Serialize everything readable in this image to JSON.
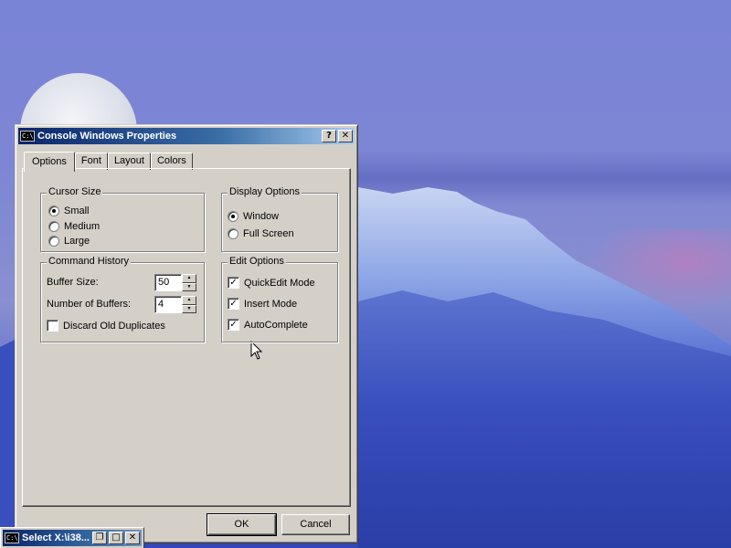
{
  "dialog": {
    "title": "Console Windows Properties",
    "app_icon_text": "C:\\",
    "help_button": "?",
    "close_button": "✕",
    "tabs": [
      "Options",
      "Font",
      "Layout",
      "Colors"
    ],
    "active_tab": "Options",
    "cursor_size": {
      "legend": "Cursor Size",
      "options": [
        "Small",
        "Medium",
        "Large"
      ],
      "selected": "Small"
    },
    "display_options": {
      "legend": "Display Options",
      "options": [
        "Window",
        "Full Screen"
      ],
      "selected": "Window"
    },
    "command_history": {
      "legend": "Command History",
      "buffer_size_label": "Buffer Size:",
      "buffer_size_value": "50",
      "num_buffers_label": "Number of Buffers:",
      "num_buffers_value": "4",
      "discard_label": "Discard Old Duplicates",
      "discard_checked": false
    },
    "edit_options": {
      "legend": "Edit Options",
      "quickedit_label": "QuickEdit Mode",
      "quickedit_checked": true,
      "insert_label": "Insert Mode",
      "insert_checked": true,
      "autocomplete_label": "AutoComplete",
      "autocomplete_checked": true
    },
    "ok_label": "OK",
    "cancel_label": "Cancel"
  },
  "taskbar_window": {
    "title": "Select X:\\i38...",
    "app_icon_text": "C:\\",
    "restore": "❐",
    "maximize": "□",
    "close": "✕"
  },
  "colors": {
    "titlebar_start": "#0a246a",
    "titlebar_end": "#a6caf0",
    "dialog_face": "#d4d0c8"
  }
}
